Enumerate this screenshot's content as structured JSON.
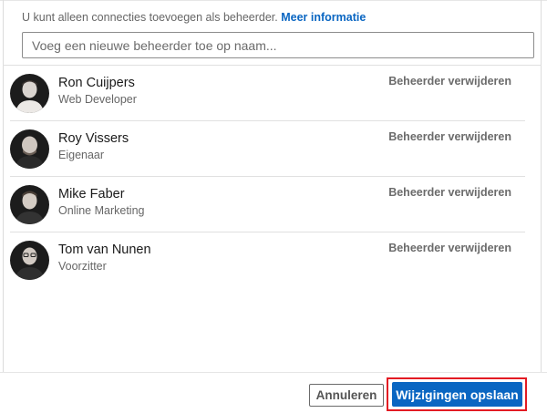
{
  "info": {
    "text": "U kunt alleen connecties toevoegen als beheerder.",
    "link": "Meer informatie"
  },
  "search": {
    "placeholder": "Voeg een nieuwe beheerder toe op naam..."
  },
  "admins": [
    {
      "name": "Ron Cuijpers",
      "role": "Web Developer",
      "remove_label": "Beheerder verwijderen"
    },
    {
      "name": "Roy Vissers",
      "role": "Eigenaar",
      "remove_label": "Beheerder verwijderen"
    },
    {
      "name": "Mike Faber",
      "role": "Online Marketing",
      "remove_label": "Beheerder verwijderen"
    },
    {
      "name": "Tom van Nunen",
      "role": "Voorzitter",
      "remove_label": "Beheerder verwijderen"
    }
  ],
  "footer": {
    "cancel_label": "Annuleren",
    "save_label": "Wijzigingen opslaan"
  },
  "colors": {
    "accent": "#0a66c2",
    "highlight": "#e31b23"
  }
}
